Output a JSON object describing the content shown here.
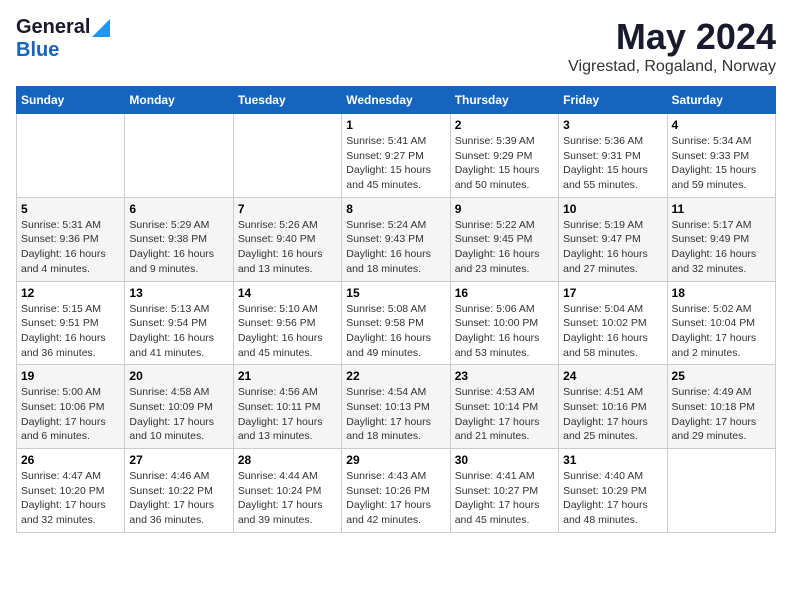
{
  "header": {
    "logo_general": "General",
    "logo_blue": "Blue",
    "title": "May 2024",
    "subtitle": "Vigrestad, Rogaland, Norway"
  },
  "weekdays": [
    "Sunday",
    "Monday",
    "Tuesday",
    "Wednesday",
    "Thursday",
    "Friday",
    "Saturday"
  ],
  "weeks": [
    [
      {
        "day": "",
        "info": ""
      },
      {
        "day": "",
        "info": ""
      },
      {
        "day": "",
        "info": ""
      },
      {
        "day": "1",
        "info": "Sunrise: 5:41 AM\nSunset: 9:27 PM\nDaylight: 15 hours\nand 45 minutes."
      },
      {
        "day": "2",
        "info": "Sunrise: 5:39 AM\nSunset: 9:29 PM\nDaylight: 15 hours\nand 50 minutes."
      },
      {
        "day": "3",
        "info": "Sunrise: 5:36 AM\nSunset: 9:31 PM\nDaylight: 15 hours\nand 55 minutes."
      },
      {
        "day": "4",
        "info": "Sunrise: 5:34 AM\nSunset: 9:33 PM\nDaylight: 15 hours\nand 59 minutes."
      }
    ],
    [
      {
        "day": "5",
        "info": "Sunrise: 5:31 AM\nSunset: 9:36 PM\nDaylight: 16 hours\nand 4 minutes."
      },
      {
        "day": "6",
        "info": "Sunrise: 5:29 AM\nSunset: 9:38 PM\nDaylight: 16 hours\nand 9 minutes."
      },
      {
        "day": "7",
        "info": "Sunrise: 5:26 AM\nSunset: 9:40 PM\nDaylight: 16 hours\nand 13 minutes."
      },
      {
        "day": "8",
        "info": "Sunrise: 5:24 AM\nSunset: 9:43 PM\nDaylight: 16 hours\nand 18 minutes."
      },
      {
        "day": "9",
        "info": "Sunrise: 5:22 AM\nSunset: 9:45 PM\nDaylight: 16 hours\nand 23 minutes."
      },
      {
        "day": "10",
        "info": "Sunrise: 5:19 AM\nSunset: 9:47 PM\nDaylight: 16 hours\nand 27 minutes."
      },
      {
        "day": "11",
        "info": "Sunrise: 5:17 AM\nSunset: 9:49 PM\nDaylight: 16 hours\nand 32 minutes."
      }
    ],
    [
      {
        "day": "12",
        "info": "Sunrise: 5:15 AM\nSunset: 9:51 PM\nDaylight: 16 hours\nand 36 minutes."
      },
      {
        "day": "13",
        "info": "Sunrise: 5:13 AM\nSunset: 9:54 PM\nDaylight: 16 hours\nand 41 minutes."
      },
      {
        "day": "14",
        "info": "Sunrise: 5:10 AM\nSunset: 9:56 PM\nDaylight: 16 hours\nand 45 minutes."
      },
      {
        "day": "15",
        "info": "Sunrise: 5:08 AM\nSunset: 9:58 PM\nDaylight: 16 hours\nand 49 minutes."
      },
      {
        "day": "16",
        "info": "Sunrise: 5:06 AM\nSunset: 10:00 PM\nDaylight: 16 hours\nand 53 minutes."
      },
      {
        "day": "17",
        "info": "Sunrise: 5:04 AM\nSunset: 10:02 PM\nDaylight: 16 hours\nand 58 minutes."
      },
      {
        "day": "18",
        "info": "Sunrise: 5:02 AM\nSunset: 10:04 PM\nDaylight: 17 hours\nand 2 minutes."
      }
    ],
    [
      {
        "day": "19",
        "info": "Sunrise: 5:00 AM\nSunset: 10:06 PM\nDaylight: 17 hours\nand 6 minutes."
      },
      {
        "day": "20",
        "info": "Sunrise: 4:58 AM\nSunset: 10:09 PM\nDaylight: 17 hours\nand 10 minutes."
      },
      {
        "day": "21",
        "info": "Sunrise: 4:56 AM\nSunset: 10:11 PM\nDaylight: 17 hours\nand 13 minutes."
      },
      {
        "day": "22",
        "info": "Sunrise: 4:54 AM\nSunset: 10:13 PM\nDaylight: 17 hours\nand 18 minutes."
      },
      {
        "day": "23",
        "info": "Sunrise: 4:53 AM\nSunset: 10:14 PM\nDaylight: 17 hours\nand 21 minutes."
      },
      {
        "day": "24",
        "info": "Sunrise: 4:51 AM\nSunset: 10:16 PM\nDaylight: 17 hours\nand 25 minutes."
      },
      {
        "day": "25",
        "info": "Sunrise: 4:49 AM\nSunset: 10:18 PM\nDaylight: 17 hours\nand 29 minutes."
      }
    ],
    [
      {
        "day": "26",
        "info": "Sunrise: 4:47 AM\nSunset: 10:20 PM\nDaylight: 17 hours\nand 32 minutes."
      },
      {
        "day": "27",
        "info": "Sunrise: 4:46 AM\nSunset: 10:22 PM\nDaylight: 17 hours\nand 36 minutes."
      },
      {
        "day": "28",
        "info": "Sunrise: 4:44 AM\nSunset: 10:24 PM\nDaylight: 17 hours\nand 39 minutes."
      },
      {
        "day": "29",
        "info": "Sunrise: 4:43 AM\nSunset: 10:26 PM\nDaylight: 17 hours\nand 42 minutes."
      },
      {
        "day": "30",
        "info": "Sunrise: 4:41 AM\nSunset: 10:27 PM\nDaylight: 17 hours\nand 45 minutes."
      },
      {
        "day": "31",
        "info": "Sunrise: 4:40 AM\nSunset: 10:29 PM\nDaylight: 17 hours\nand 48 minutes."
      },
      {
        "day": "",
        "info": ""
      }
    ]
  ]
}
